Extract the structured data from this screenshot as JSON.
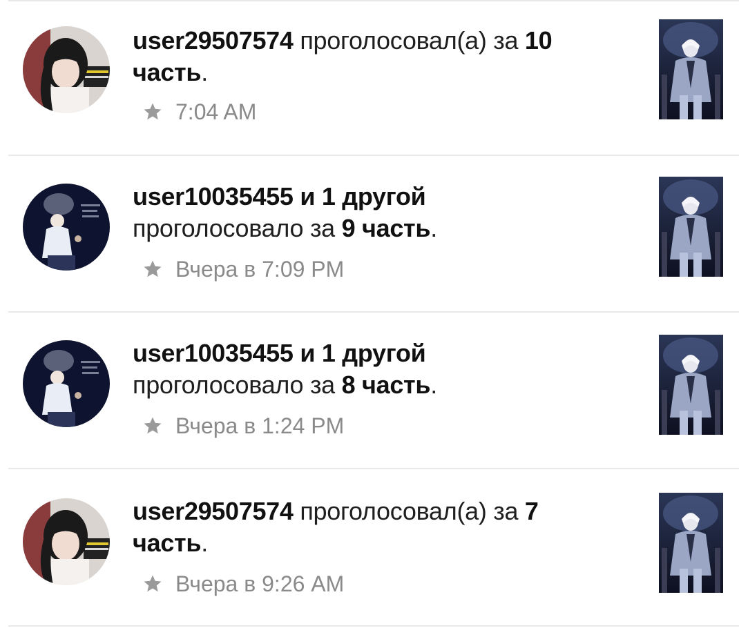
{
  "notifications": [
    {
      "user": "user29507574",
      "mid": " проголосовал(а) за ",
      "part_num": "10",
      "line2_bold": "часть",
      "line2_tail": ".",
      "time": "7:04 AM",
      "avatar": "girl-avatar"
    },
    {
      "user": "user10035455 и 1 другой",
      "mid": "",
      "part_num": "",
      "line2_pre": "проголосовало за ",
      "line2_bold": "9 часть",
      "line2_tail": ".",
      "time": "Вчера в 7:09 PM",
      "avatar": "man-smoking-avatar"
    },
    {
      "user": "user10035455 и 1 другой",
      "mid": "",
      "part_num": "",
      "line2_pre": "проголосовало за ",
      "line2_bold": "8 часть",
      "line2_tail": ".",
      "time": "Вчера в 1:24 PM",
      "avatar": "man-smoking-avatar"
    },
    {
      "user": "user29507574",
      "mid": " проголосовал(а) за ",
      "part_num": "7",
      "line2_bold": "часть",
      "line2_tail": ".",
      "time": "Вчера в 9:26 AM",
      "avatar": "girl-avatar"
    }
  ],
  "icons": {
    "star": "star-icon",
    "cover": "book-cover-thumbnail"
  },
  "colors": {
    "text": "#1f1f1f",
    "meta": "#8a8a8a",
    "separator": "#e8e8e8"
  }
}
